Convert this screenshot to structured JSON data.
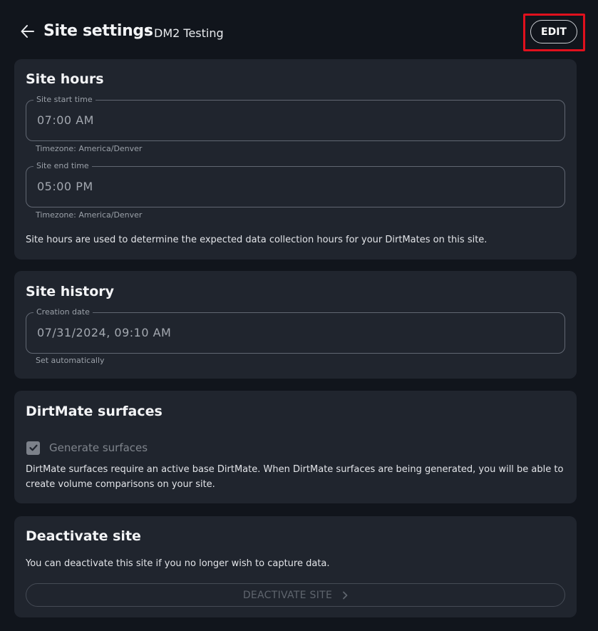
{
  "header": {
    "back_icon": "arrow-left-icon",
    "title": "Site settings",
    "separator": "•",
    "site_name": "DM2 Testing",
    "edit_label": "EDIT",
    "highlight_color": "#e0101d"
  },
  "site_hours": {
    "title": "Site hours",
    "start_label": "Site start time",
    "start_value": "07:00 AM",
    "start_helper": "Timezone: America/Denver",
    "end_label": "Site end time",
    "end_value": "05:00 PM",
    "end_helper": "Timezone: America/Denver",
    "description": "Site hours are used to determine the expected data collection hours for your DirtMates on this site."
  },
  "site_history": {
    "title": "Site history",
    "creation_label": "Creation date",
    "creation_value": "07/31/2024, 09:10 AM",
    "creation_helper": "Set automatically"
  },
  "surfaces": {
    "title": "DirtMate surfaces",
    "checkbox_label": "Generate surfaces",
    "checkbox_checked": true,
    "description": "DirtMate surfaces require an active base DirtMate. When DirtMate surfaces are being generated, you will be able to create volume comparisons on your site."
  },
  "deactivate": {
    "title": "Deactivate site",
    "description": "You can deactivate this site if you no longer wish to capture data.",
    "button_label": "DEACTIVATE SITE",
    "button_icon": "chevron-right-icon"
  },
  "colors": {
    "background": "#11151c",
    "card": "#20252e",
    "text": "#e8eaed"
  }
}
